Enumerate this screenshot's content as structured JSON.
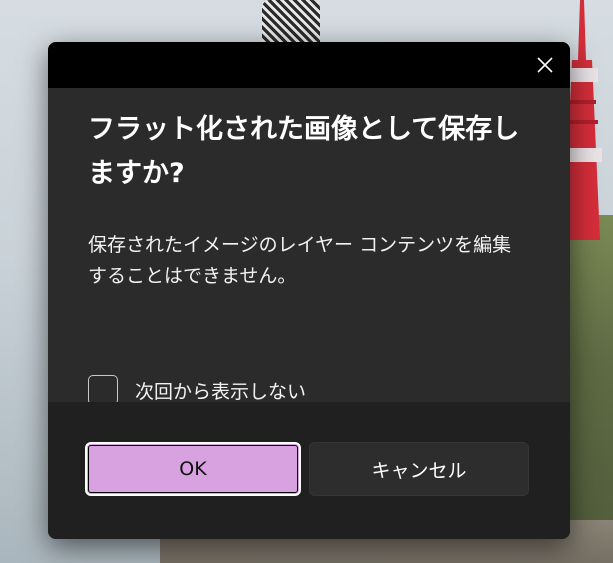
{
  "dialog": {
    "heading": "フラット化された画像として保存しますか?",
    "message": "保存されたイメージのレイヤー コンテンツを編集することはできません。",
    "checkbox": {
      "label": "次回から表示しない",
      "checked": false
    },
    "buttons": {
      "ok_label": "OK",
      "cancel_label": "キャンセル"
    },
    "close_icon": "close-icon"
  },
  "colors": {
    "titlebar": "#000000",
    "dialog_bg": "#2b2b2b",
    "footer_bg": "#202020",
    "accent_button": "#d8a2e0"
  }
}
